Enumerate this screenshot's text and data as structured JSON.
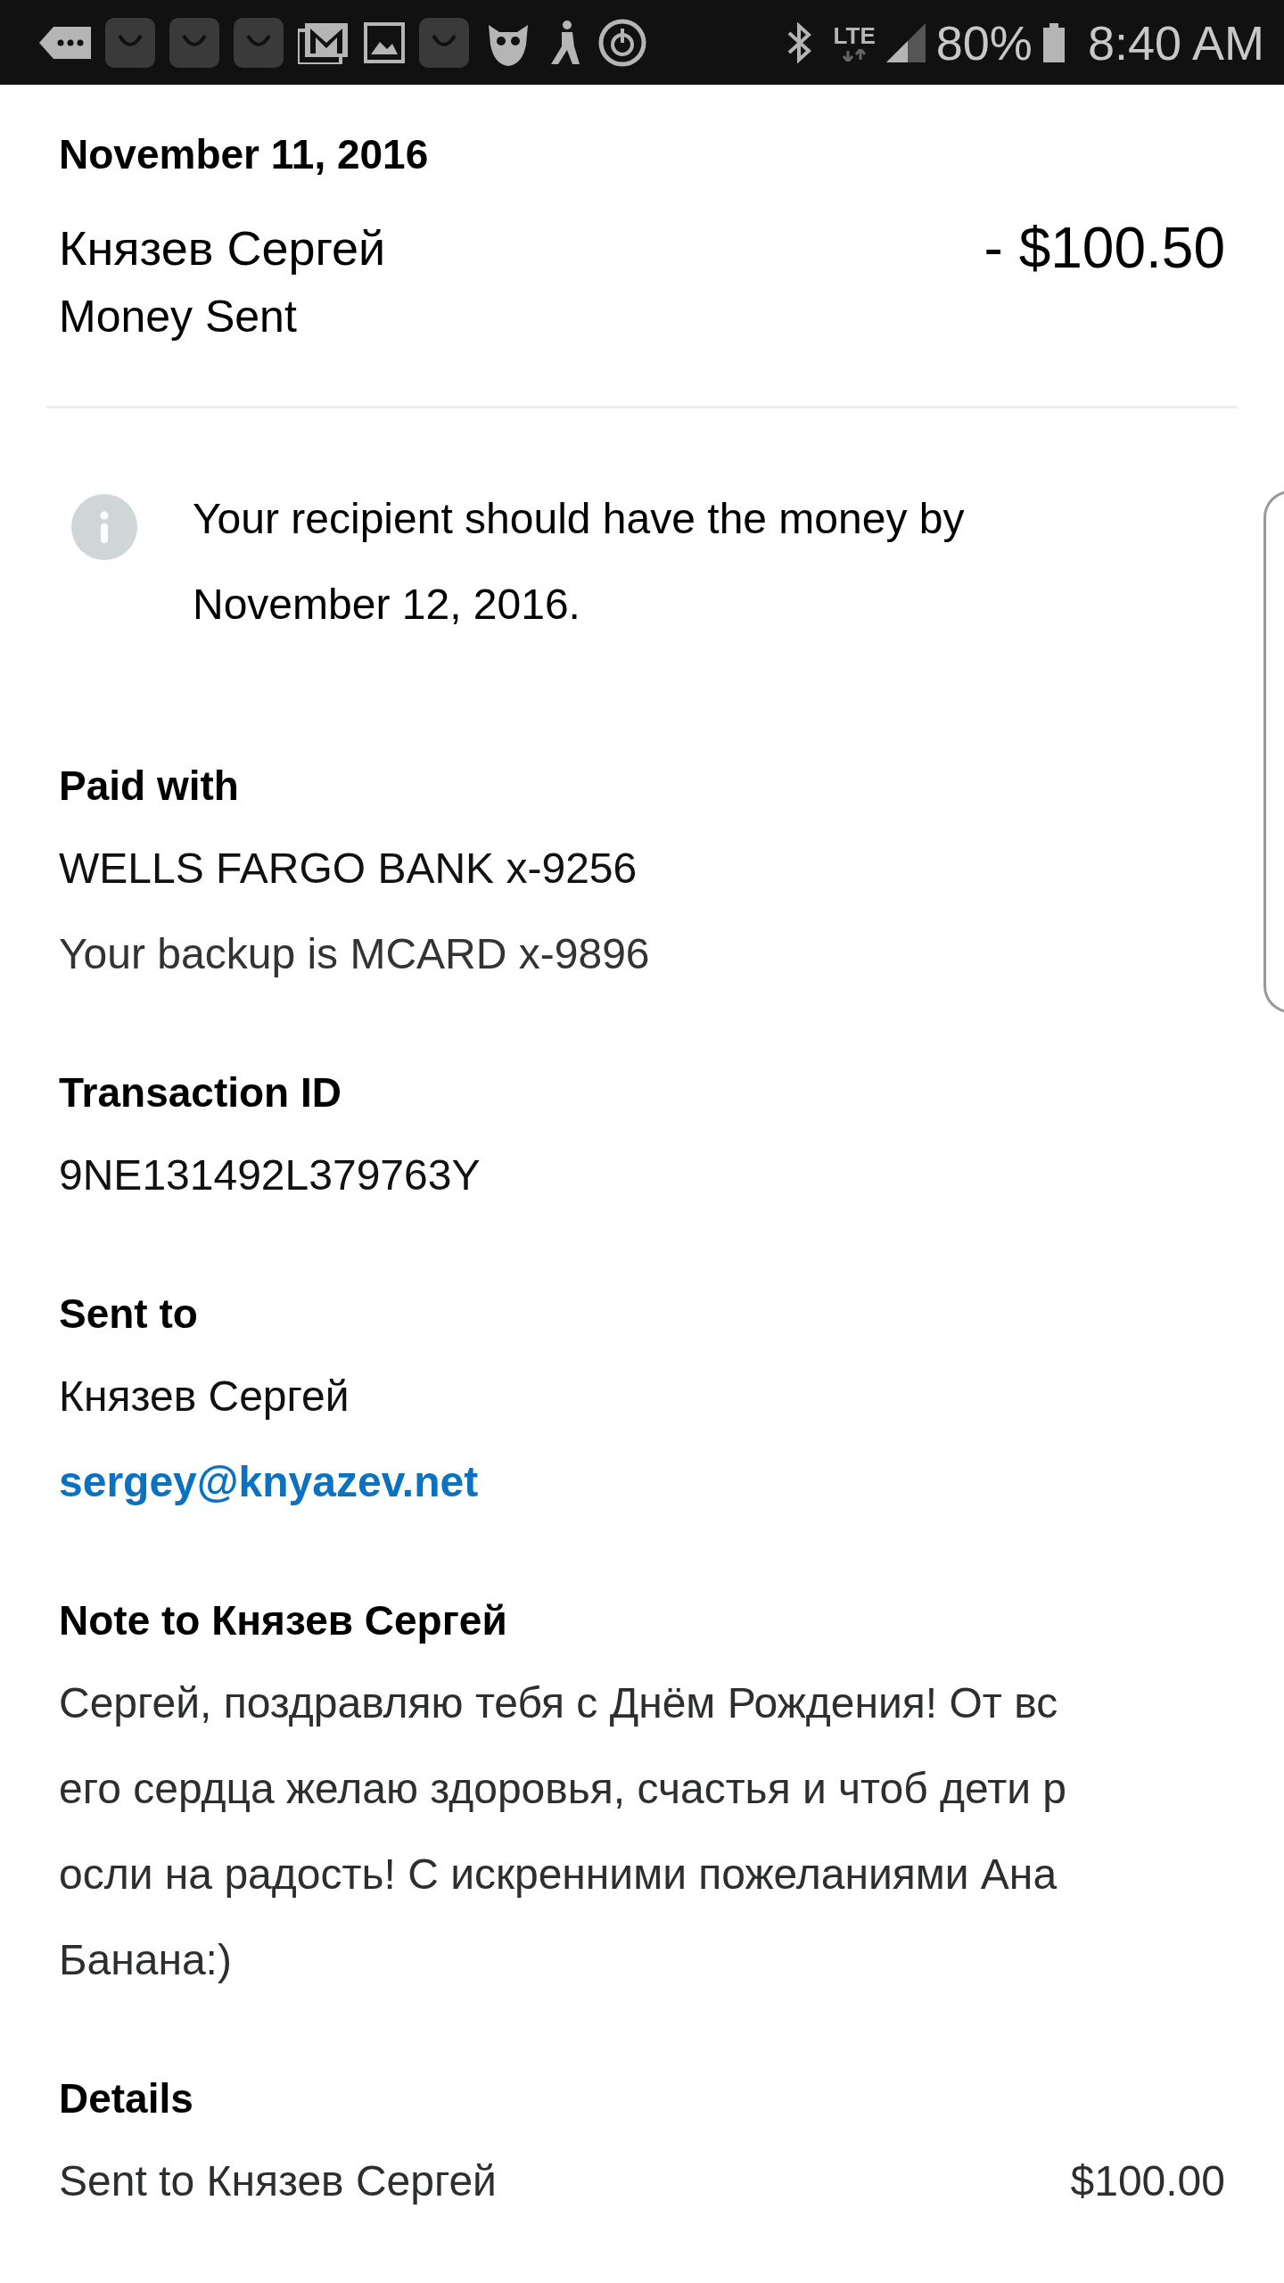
{
  "status_bar": {
    "network": "LTE",
    "battery": "80%",
    "time": "8:40 AM"
  },
  "header": {
    "date": "November 11, 2016",
    "name": "Князев Сергей",
    "amount": "- $100.50",
    "type": "Money Sent"
  },
  "notice": {
    "text": "Your recipient should have the money by November 12, 2016."
  },
  "sections": [
    {
      "title": "Paid with",
      "lines": [
        {
          "text": "WELLS FARGO BANK x-9256",
          "kind": "plain"
        },
        {
          "text": "Your backup is MCARD x-9896",
          "kind": "muted"
        }
      ]
    },
    {
      "title": "Transaction ID",
      "lines": [
        {
          "text": "9NE131492L379763Y",
          "kind": "plain"
        }
      ]
    },
    {
      "title": "Sent to",
      "lines": [
        {
          "text": "Князев Сергей",
          "kind": "plain"
        },
        {
          "text": "sergey@knyazev.net",
          "kind": "link"
        }
      ]
    },
    {
      "title": "Note to Князев Сергей",
      "lines": [
        {
          "text": "Сергей, поздравляю тебя с Днём Рождения! От вс",
          "kind": "note"
        },
        {
          "text": "его сердца желаю здоровья, счастья и чтоб дети р",
          "kind": "note"
        },
        {
          "text": "осли на радость! С искренними пожеланиями Ана",
          "kind": "note"
        },
        {
          "text": "Банана:)",
          "kind": "note"
        }
      ]
    },
    {
      "title": "Details",
      "rows": [
        {
          "label": "Sent to Князев Сергей",
          "value": "$100.00"
        }
      ]
    }
  ]
}
